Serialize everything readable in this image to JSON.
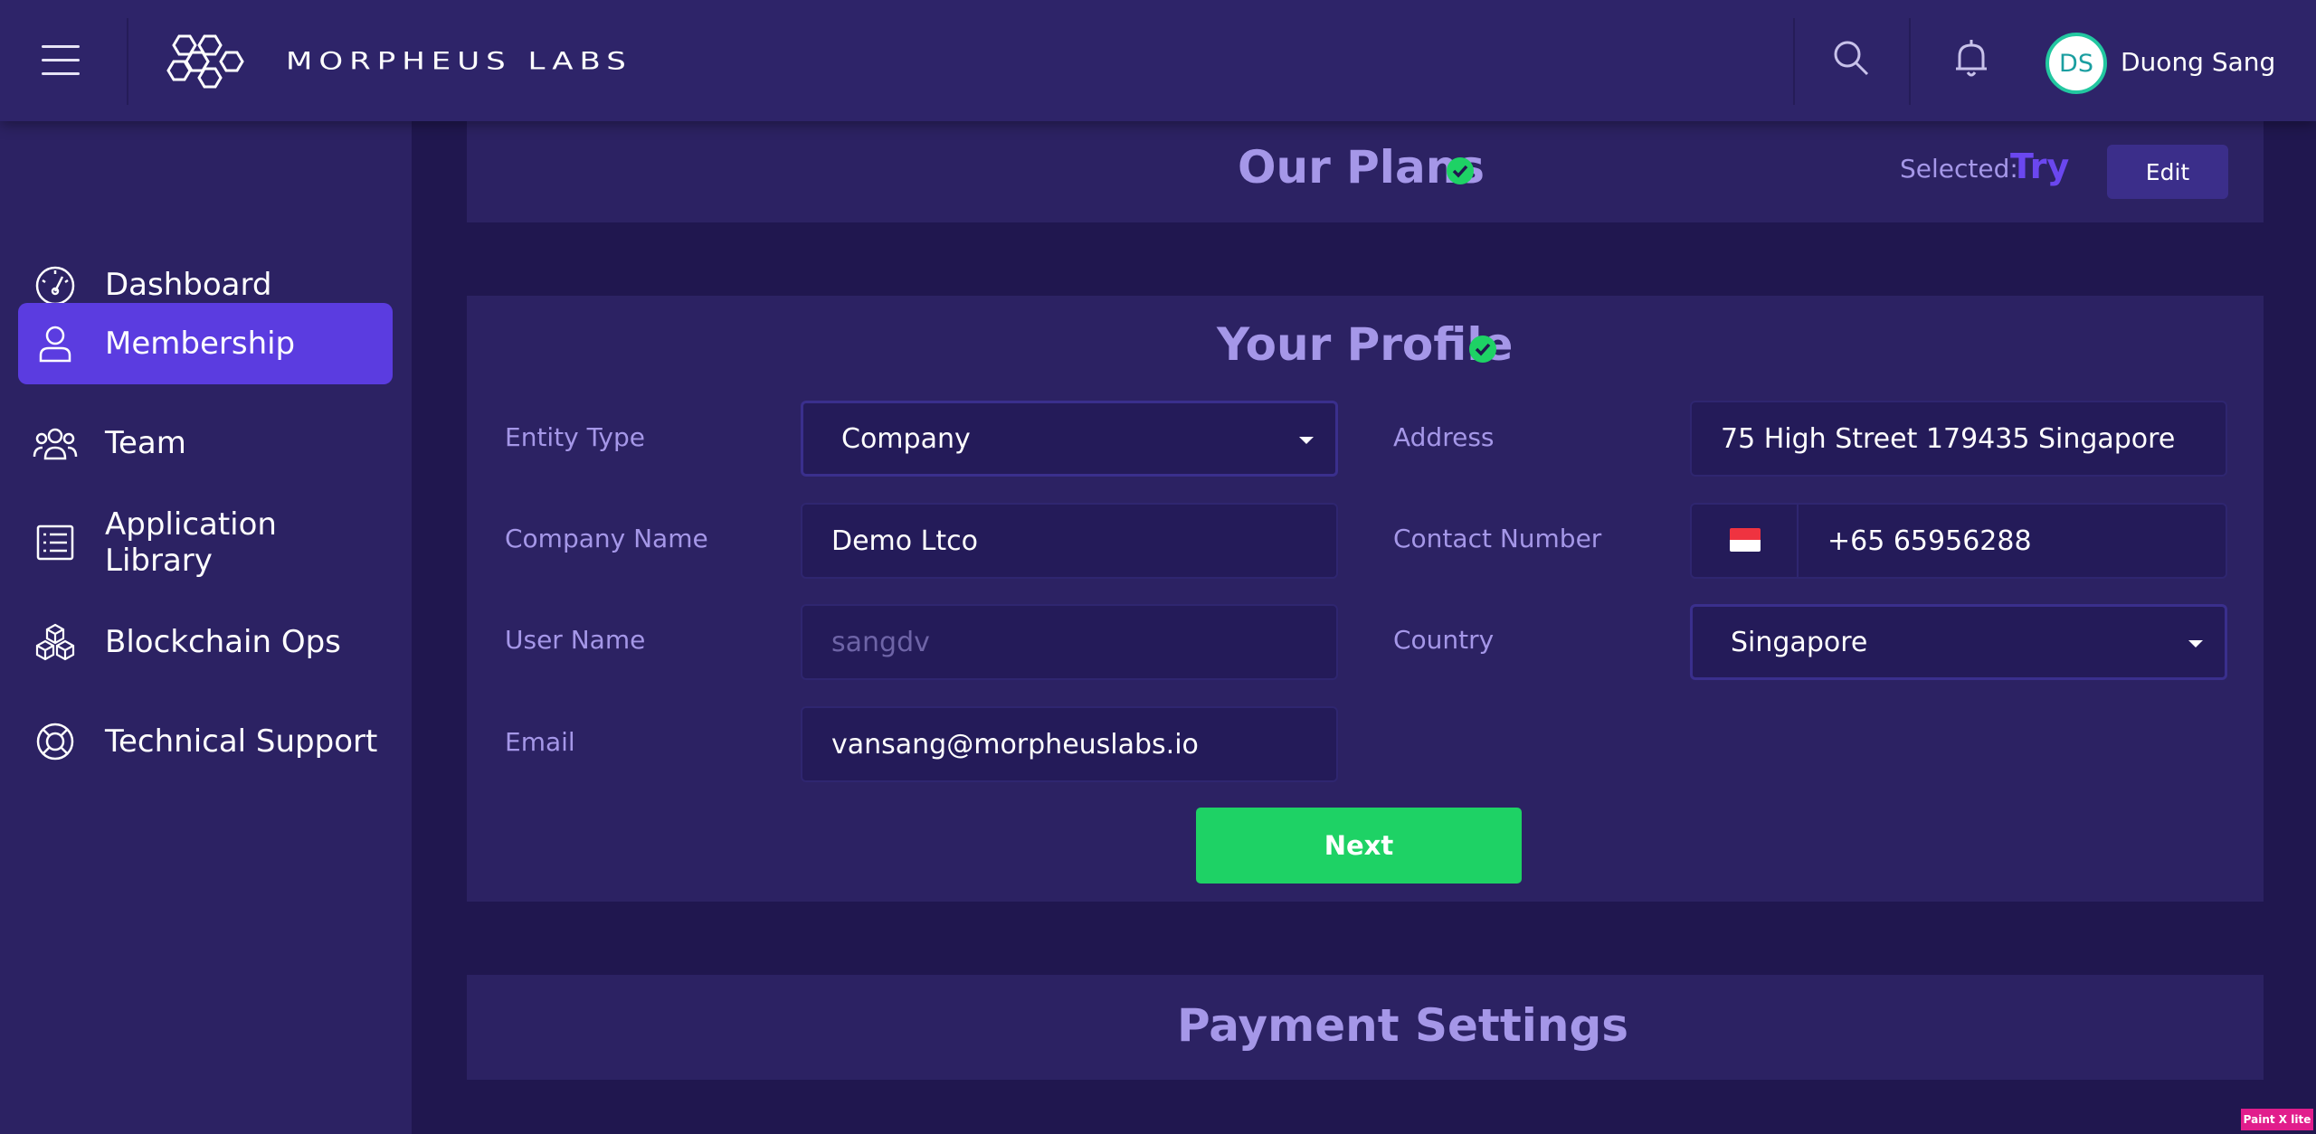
{
  "header": {
    "brand": "MORPHEUS LABS",
    "user": {
      "initials": "DS",
      "name": "Duong Sang"
    }
  },
  "sidebar": {
    "items": [
      {
        "label": "Dashboard",
        "icon": "speedometer-icon",
        "active": false
      },
      {
        "label": "Membership",
        "icon": "user-icon",
        "active": true
      },
      {
        "label": "Team",
        "icon": "team-icon",
        "active": false
      },
      {
        "label": "Application Library",
        "icon": "list-icon",
        "active": false
      },
      {
        "label": "Blockchain Ops",
        "icon": "cubes-icon",
        "active": false
      },
      {
        "label": "Technical Support",
        "icon": "lifebuoy-icon",
        "active": false
      }
    ]
  },
  "plans": {
    "title": "Our Plans",
    "selected_label": "Selected:",
    "selected_value": "Try",
    "edit_label": "Edit"
  },
  "profile": {
    "title": "Your Profile",
    "entity_type": {
      "label": "Entity Type",
      "value": "Company"
    },
    "company_name": {
      "label": "Company Name",
      "value": "Demo Ltco"
    },
    "user_name": {
      "label": "User Name",
      "value": "sangdv"
    },
    "email": {
      "label": "Email",
      "value": "vansang@morpheuslabs.io"
    },
    "address": {
      "label": "Address",
      "value": "75 High Street 179435 Singapore"
    },
    "contact_number": {
      "label": "Contact Number",
      "value": "+65 65956288",
      "flag": "singapore-flag-icon"
    },
    "country": {
      "label": "Country",
      "value": "Singapore"
    },
    "next_label": "Next"
  },
  "payment": {
    "title": "Payment Settings"
  },
  "watermark": "Paint X lite",
  "colors": {
    "background": "#20174f",
    "header": "#2e2469",
    "sidebar": "#2c2263",
    "active_nav": "#5b3ce0",
    "accent_text": "#a597e8",
    "success": "#1ed265"
  }
}
